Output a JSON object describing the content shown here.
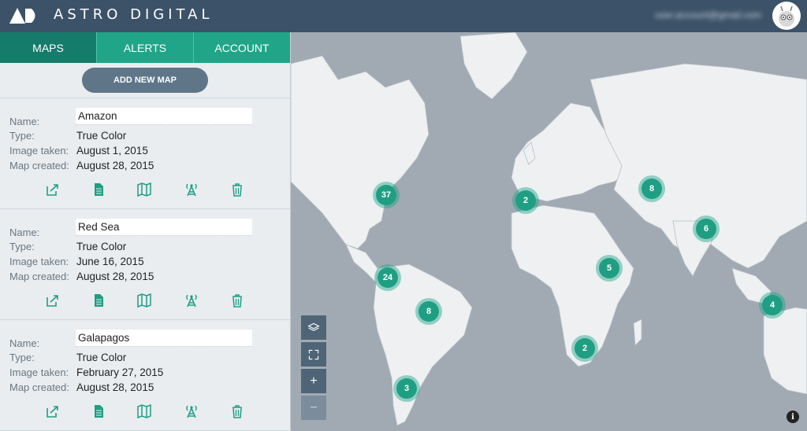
{
  "header": {
    "brand": "ASTRO DIGITAL",
    "user_email": "user.account@gmail.com"
  },
  "tabs": [
    {
      "label": "MAPS",
      "active": true
    },
    {
      "label": "ALERTS",
      "active": false
    },
    {
      "label": "ACCOUNT",
      "active": false
    }
  ],
  "add_button": "ADD NEW MAP",
  "labels": {
    "name": "Name:",
    "type": "Type:",
    "image_taken": "Image taken:",
    "map_created": "Map created:"
  },
  "maps": [
    {
      "name": "Amazon",
      "type": "True Color",
      "image_taken": "August 1, 2015",
      "map_created": "August 28, 2015"
    },
    {
      "name": "Red Sea",
      "type": "True Color",
      "image_taken": "June 16, 2015",
      "map_created": "August 28, 2015"
    },
    {
      "name": "Galapagos",
      "type": "True Color",
      "image_taken": "February 27, 2015",
      "map_created": "August 28, 2015"
    }
  ],
  "card_icons": [
    "share-icon",
    "document-icon",
    "map-icon",
    "tower-icon",
    "trash-icon"
  ],
  "clusters": [
    {
      "count": "37",
      "region": "north-america-east"
    },
    {
      "count": "2",
      "region": "iberia"
    },
    {
      "count": "8",
      "region": "central-asia"
    },
    {
      "count": "6",
      "region": "india"
    },
    {
      "count": "24",
      "region": "central-america"
    },
    {
      "count": "5",
      "region": "east-africa"
    },
    {
      "count": "8",
      "region": "brazil"
    },
    {
      "count": "4",
      "region": "southeast-asia"
    },
    {
      "count": "2",
      "region": "south-africa"
    },
    {
      "count": "3",
      "region": "patagonia"
    }
  ],
  "map_controls": {
    "layers": "layers-icon",
    "fullscreen": "fullscreen-icon",
    "zoom_in": "+",
    "zoom_out": "−"
  },
  "info_label": "i",
  "colors": {
    "header": "#3c5268",
    "tab": "#20a589",
    "tab_active": "#157b6a",
    "accent": "#1f9e84",
    "ocean": "#a1aab3",
    "land": "#eef0f2"
  }
}
